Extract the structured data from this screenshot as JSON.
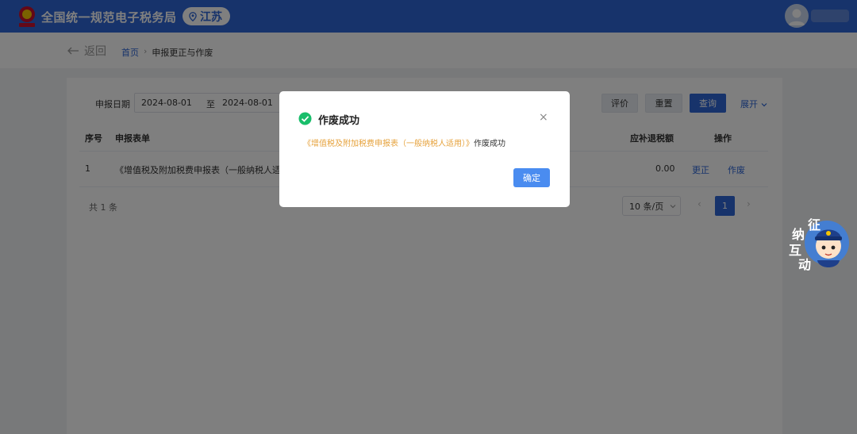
{
  "header": {
    "title": "全国统一规范电子税务局",
    "region": "江苏"
  },
  "nav": {
    "back_label": "返回",
    "breadcrumb": [
      "首页",
      "申报更正与作废"
    ],
    "breadcrumb_sep": "›"
  },
  "filter": {
    "date_label": "申报日期",
    "date_start": "2024-08-01",
    "date_to": "至",
    "date_end": "2024-08-01",
    "buttons": {
      "evaluate": "评价",
      "reset": "重置",
      "query": "查询",
      "expand": "展开"
    }
  },
  "table": {
    "columns": {
      "index": "序号",
      "form": "申报表单",
      "amount": "应补退税额",
      "ops": "操作"
    },
    "rows": [
      {
        "index": "1",
        "form": "《增值税及附加税费申报表（一般纳税人适用",
        "amount": "0.00",
        "action_correct": "更正",
        "action_void": "作废"
      }
    ]
  },
  "pagination": {
    "total": "共 1 条",
    "page_size": "10 条/页",
    "prev": "‹",
    "current": "1",
    "next": "›"
  },
  "mascot": {
    "chars": [
      "征",
      "纳",
      "互",
      "动"
    ]
  },
  "dialog": {
    "title": "作废成功",
    "close": "×",
    "message_highlight": "《增值税及附加税费申报表（一般纳税人适用）》",
    "message_rest": "作废成功",
    "confirm": "确定"
  },
  "colors": {
    "primary": "#2e67d6",
    "success": "#19be6b",
    "warning": "#e6a23c"
  }
}
